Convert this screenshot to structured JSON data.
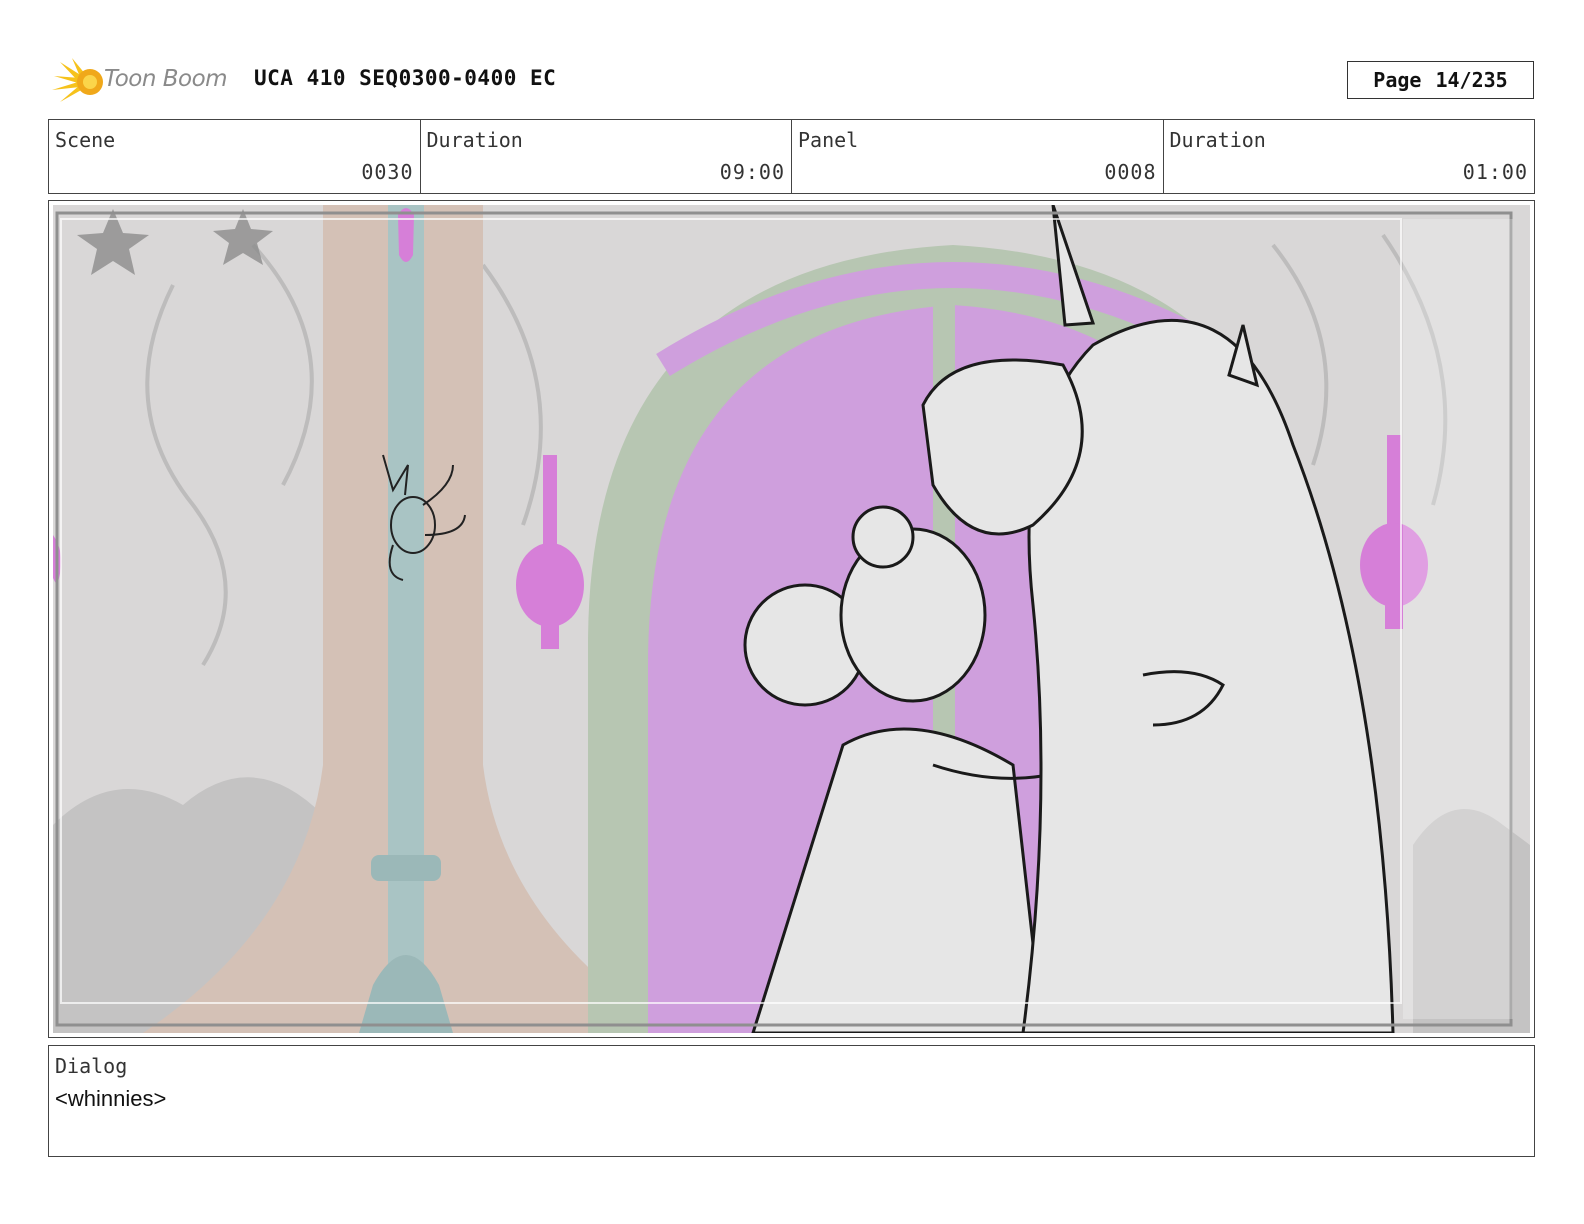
{
  "header": {
    "logo_text": "Toon Boom",
    "title": "UCA 410 SEQ0300-0400 EC",
    "page_label": "Page",
    "page_value": "14/235"
  },
  "info": {
    "scene_label": "Scene",
    "scene_value": "0030",
    "scene_duration_label": "Duration",
    "scene_duration_value": "09:00",
    "panel_label": "Panel",
    "panel_value": "0008",
    "panel_duration_label": "Duration",
    "panel_duration_value": "01:00"
  },
  "panel": {
    "image_icon": "storyboard-drawing",
    "colors": {
      "wall": "#d9d7d7",
      "arch": "#b7c6b2",
      "window": "#cf9fdd",
      "pillar": "#a9c4c4",
      "drape": "#d4c1b6",
      "accent": "#d67fd8"
    }
  },
  "dialog": {
    "label": "Dialog",
    "text": "<whinnies>"
  }
}
